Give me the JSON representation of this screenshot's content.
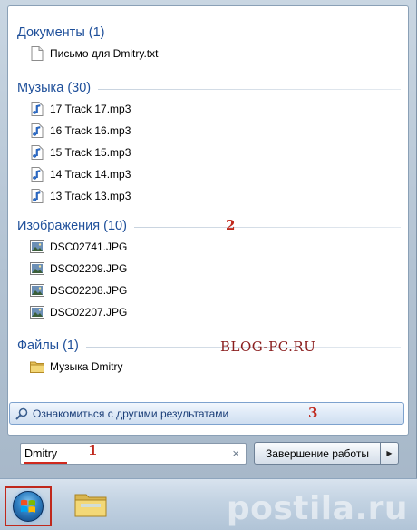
{
  "sections": {
    "documents": {
      "header": "Документы (1)",
      "items": [
        "Письмо для Dmitry.txt"
      ]
    },
    "music": {
      "header": "Музыка (30)",
      "items": [
        "17 Track 17.mp3",
        "16 Track 16.mp3",
        "15 Track 15.mp3",
        "14 Track 14.mp3",
        "13 Track 13.mp3"
      ]
    },
    "images": {
      "header": "Изображения (10)",
      "items": [
        "DSC02741.JPG",
        "DSC02209.JPG",
        "DSC02208.JPG",
        "DSC02207.JPG"
      ]
    },
    "files": {
      "header": "Файлы (1)",
      "items": [
        "Музыка Dmitry"
      ]
    }
  },
  "more_results": {
    "label": "Ознакомиться с другими результатами"
  },
  "search": {
    "value": "Dmitry",
    "clear_glyph": "×"
  },
  "shutdown": {
    "label": "Завершение работы",
    "arrow": "▶"
  },
  "annotations": {
    "one": "1",
    "two": "2",
    "three": "3",
    "blog": "BLOG-PC.RU"
  },
  "watermark": {
    "text": "postila.ru"
  },
  "colors": {
    "section_header": "#1e4f9a",
    "annotation_red": "#c0281c",
    "panel_bg": "#ffffff",
    "frame_bg": "#b3c3d3"
  }
}
